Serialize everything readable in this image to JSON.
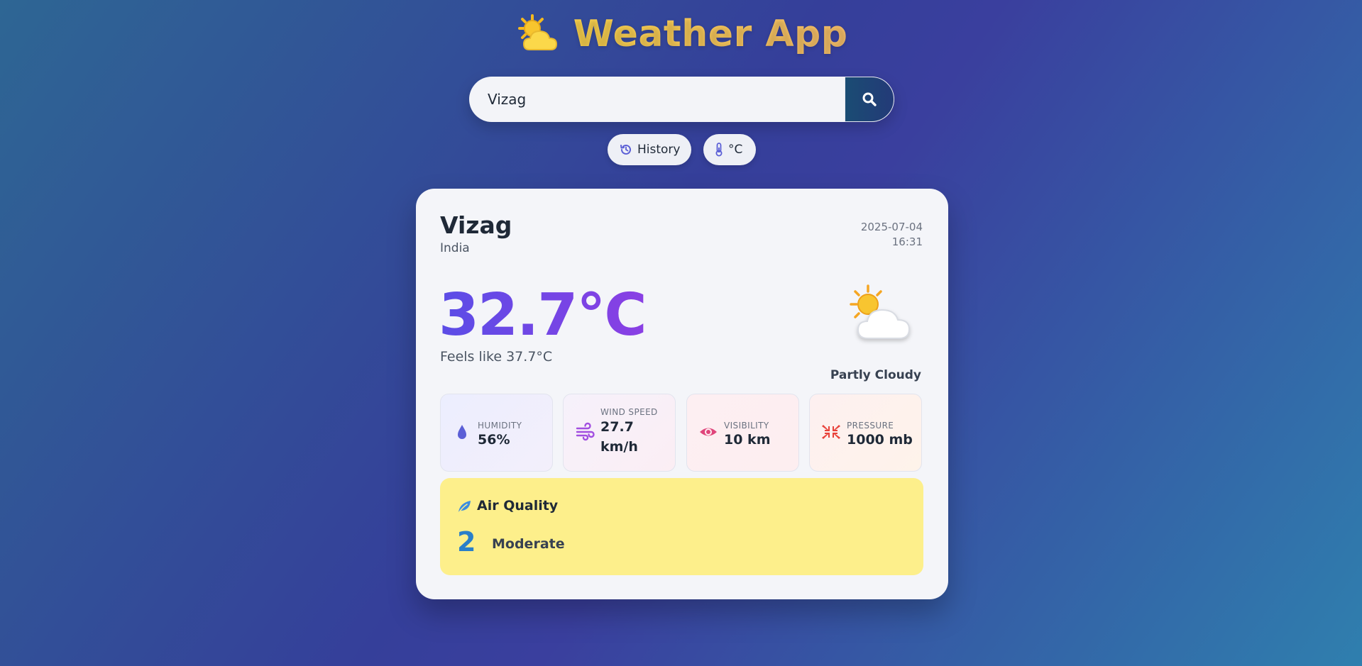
{
  "header": {
    "title": "Weather App",
    "logo_icon": "sun-behind-cloud-icon"
  },
  "search": {
    "value": "Vizag",
    "placeholder": "",
    "button_icon": "search-icon"
  },
  "controls": {
    "history_label": "History",
    "unit_label": "°C"
  },
  "weather": {
    "city": "Vizag",
    "country": "India",
    "date": "2025-07-04",
    "time": "16:31",
    "temperature": "32.7°C",
    "feels_like": "Feels like 37.7°C",
    "condition": "Partly Cloudy",
    "condition_icon": "partly-cloudy-icon"
  },
  "stats": {
    "humidity": {
      "label": "HUMIDITY",
      "value": "56%"
    },
    "wind": {
      "label": "WIND SPEED",
      "value": "27.7 km/h"
    },
    "visibility": {
      "label": "VISIBILITY",
      "value": "10 km"
    },
    "pressure": {
      "label": "PRESSURE",
      "value": "1000 mb"
    }
  },
  "air_quality": {
    "title": "Air Quality",
    "index": "2",
    "label": "Moderate"
  },
  "colors": {
    "accent_yellow": "#fbd34d",
    "temperature_gradient_start": "#5b4de6",
    "temperature_gradient_end": "#8a3fe4",
    "air_quality_bg": "#fdef8b",
    "aq_index_color": "#2a7fc9"
  }
}
